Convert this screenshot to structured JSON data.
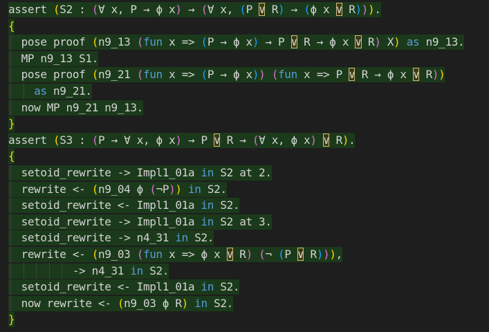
{
  "editor": {
    "lines": [
      [
        [
          "assert ",
          ""
        ],
        [
          "(",
          "p1"
        ],
        [
          "S2 : ",
          ""
        ],
        [
          "(",
          "p2"
        ],
        [
          "∀ x, P → ϕ x",
          ""
        ],
        [
          ")",
          "p2"
        ],
        [
          " → ",
          ""
        ],
        [
          "(",
          "p2"
        ],
        [
          "∀ x, ",
          ""
        ],
        [
          "(",
          "p3"
        ],
        [
          "P ",
          ""
        ],
        [
          "∨",
          "hl"
        ],
        [
          " R",
          ""
        ],
        [
          ")",
          "p3"
        ],
        [
          " → ",
          ""
        ],
        [
          "(",
          "p3"
        ],
        [
          "ϕ x ",
          ""
        ],
        [
          "∨",
          "hl"
        ],
        [
          " R",
          ""
        ],
        [
          ")",
          "p3"
        ],
        [
          ")",
          "p2"
        ],
        [
          ")",
          "p1"
        ],
        [
          ".",
          ""
        ]
      ],
      [
        [
          "{",
          "p1"
        ]
      ],
      [
        [
          "  pose proof ",
          ""
        ],
        [
          "(",
          "p1"
        ],
        [
          "n9_13 ",
          ""
        ],
        [
          "(",
          "p2"
        ],
        [
          "fun",
          "kw"
        ],
        [
          " x => ",
          ""
        ],
        [
          "(",
          "p3"
        ],
        [
          "P → ϕ x",
          ""
        ],
        [
          ")",
          "p3"
        ],
        [
          " → P ",
          ""
        ],
        [
          "∨",
          "hl"
        ],
        [
          " R → ϕ x ",
          ""
        ],
        [
          "∨",
          "hl"
        ],
        [
          " R",
          ""
        ],
        [
          ")",
          "p2"
        ],
        [
          " X",
          ""
        ],
        [
          ")",
          "p1"
        ],
        [
          " ",
          ""
        ],
        [
          "as",
          "kw"
        ],
        [
          " n9_13.",
          ""
        ]
      ],
      [
        [
          "  MP n9_13 S1.",
          ""
        ]
      ],
      [
        [
          "  pose proof ",
          ""
        ],
        [
          "(",
          "p1"
        ],
        [
          "n9_21 ",
          ""
        ],
        [
          "(",
          "p2"
        ],
        [
          "fun",
          "kw"
        ],
        [
          " x => ",
          ""
        ],
        [
          "(",
          "p3"
        ],
        [
          "P → ϕ x",
          ""
        ],
        [
          ")",
          "p3"
        ],
        [
          ")",
          "p2"
        ],
        [
          " ",
          ""
        ],
        [
          "(",
          "p2"
        ],
        [
          "fun",
          "kw"
        ],
        [
          " x => P ",
          ""
        ],
        [
          "∨",
          "hl"
        ],
        [
          " R → ϕ x ",
          ""
        ],
        [
          "∨",
          "hl"
        ],
        [
          " R",
          ""
        ],
        [
          ")",
          "p2"
        ],
        [
          ")",
          "p1"
        ]
      ],
      [
        [
          "    ",
          ""
        ],
        [
          "as",
          "kw"
        ],
        [
          " n9_21.",
          ""
        ]
      ],
      [
        [
          "  now MP n9_21 n9_13.",
          ""
        ]
      ],
      [
        [
          "}",
          "p1"
        ]
      ],
      [
        [
          "assert ",
          ""
        ],
        [
          "(",
          "p1"
        ],
        [
          "S3 : ",
          ""
        ],
        [
          "(",
          "p2"
        ],
        [
          "P → ∀ x, ϕ x",
          ""
        ],
        [
          ")",
          "p2"
        ],
        [
          " → P ",
          ""
        ],
        [
          "∨",
          "hl"
        ],
        [
          " R → ",
          ""
        ],
        [
          "(",
          "p2"
        ],
        [
          "∀ x, ϕ x",
          ""
        ],
        [
          ")",
          "p2"
        ],
        [
          " ",
          ""
        ],
        [
          "∨",
          "hl"
        ],
        [
          " R",
          ""
        ],
        [
          ")",
          "p1"
        ],
        [
          ".",
          ""
        ]
      ],
      [
        [
          "{",
          "p1"
        ]
      ],
      [
        [
          "  setoid_rewrite -> Impl1_01a ",
          ""
        ],
        [
          "in",
          "kw"
        ],
        [
          " S2 at 2.",
          ""
        ]
      ],
      [
        [
          "  rewrite <- ",
          ""
        ],
        [
          "(",
          "p1"
        ],
        [
          "n9_04 ϕ ",
          ""
        ],
        [
          "(",
          "p2"
        ],
        [
          "¬P",
          ""
        ],
        [
          ")",
          "p2"
        ],
        [
          ")",
          "p1"
        ],
        [
          " ",
          ""
        ],
        [
          "in",
          "kw"
        ],
        [
          " S2.",
          ""
        ]
      ],
      [
        [
          "  setoid_rewrite <- Impl1_01a ",
          ""
        ],
        [
          "in",
          "kw"
        ],
        [
          " S2.",
          ""
        ]
      ],
      [
        [
          "  setoid_rewrite -> Impl1_01a ",
          ""
        ],
        [
          "in",
          "kw"
        ],
        [
          " S2 at 3.",
          ""
        ]
      ],
      [
        [
          "  setoid_rewrite -> n4_31 ",
          ""
        ],
        [
          "in",
          "kw"
        ],
        [
          " S2.",
          ""
        ]
      ],
      [
        [
          "  rewrite <- ",
          ""
        ],
        [
          "(",
          "p1"
        ],
        [
          "n9_03 ",
          ""
        ],
        [
          "(",
          "p2"
        ],
        [
          "fun",
          "kw"
        ],
        [
          " x => ϕ x ",
          ""
        ],
        [
          "∨",
          "hl"
        ],
        [
          " R",
          ""
        ],
        [
          ")",
          "p2"
        ],
        [
          " ",
          ""
        ],
        [
          "(",
          "p2"
        ],
        [
          "¬ ",
          ""
        ],
        [
          "(",
          "p3"
        ],
        [
          "P ",
          ""
        ],
        [
          "∨",
          "hl"
        ],
        [
          " R",
          ""
        ],
        [
          ")",
          "p3"
        ],
        [
          ")",
          "p2"
        ],
        [
          ")",
          "p1"
        ],
        [
          ",",
          ""
        ]
      ],
      [
        [
          "          -> n4_31 ",
          ""
        ],
        [
          "in",
          "kw"
        ],
        [
          " S2.",
          ""
        ]
      ],
      [
        [
          "  setoid_rewrite <- Impl1_01a ",
          ""
        ],
        [
          "in",
          "kw"
        ],
        [
          " S2.",
          ""
        ]
      ],
      [
        [
          "  now rewrite <- ",
          ""
        ],
        [
          "(",
          "p1"
        ],
        [
          "n9_03 ϕ R",
          ""
        ],
        [
          ")",
          "p1"
        ],
        [
          " ",
          ""
        ],
        [
          "in",
          "kw"
        ],
        [
          " S2.",
          ""
        ]
      ],
      [
        [
          "}",
          "p1"
        ]
      ]
    ]
  }
}
